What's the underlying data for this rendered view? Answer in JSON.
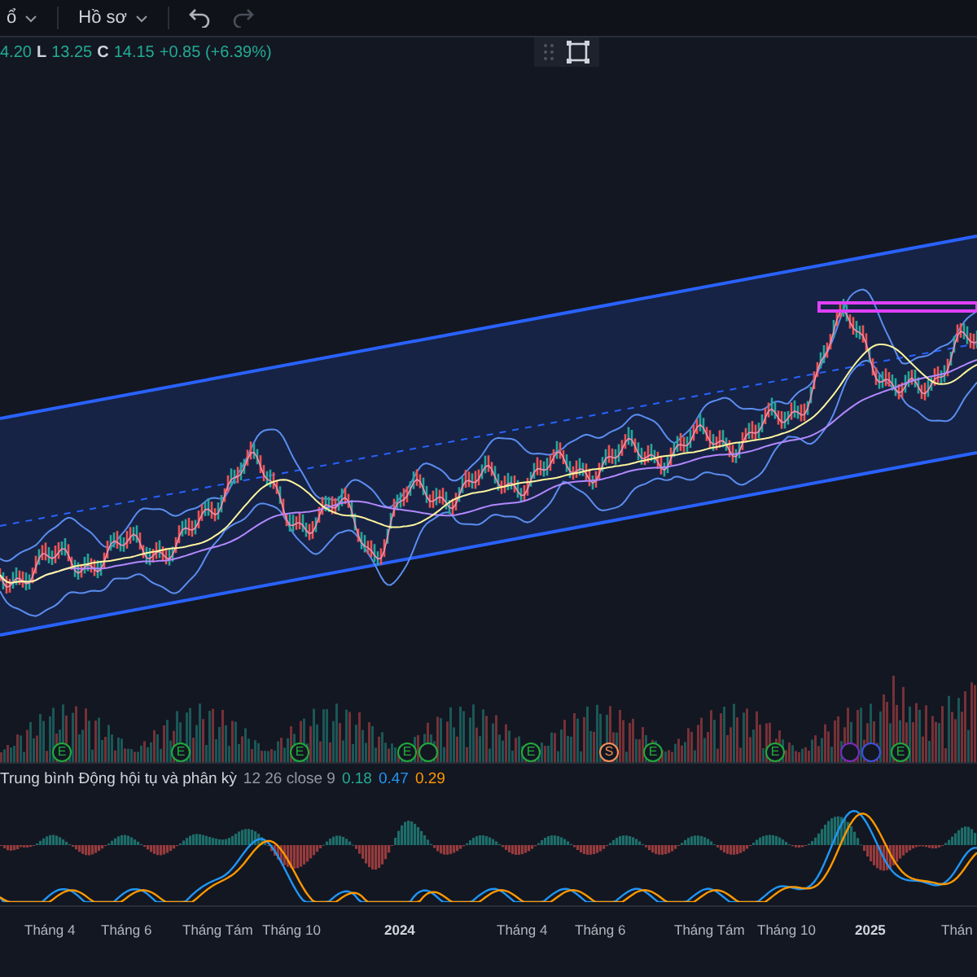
{
  "toolbar": {
    "menus": [
      {
        "label": "ổ"
      },
      {
        "label": "Hồ sơ"
      }
    ]
  },
  "legend": {
    "items": [
      {
        "value": "4.20"
      },
      {
        "key": "L",
        "value": "13.25"
      },
      {
        "key": "C",
        "value": "14.15"
      }
    ],
    "change": "+0.85 (+6.39%)"
  },
  "events": [
    {
      "kind": "letter",
      "letter": "E",
      "color": "#22ab3c"
    },
    {
      "kind": "letter",
      "letter": "E",
      "color": "#22ab3c"
    },
    {
      "kind": "letter",
      "letter": "E",
      "color": "#22ab3c"
    },
    {
      "kind": "letter",
      "letter": "E",
      "color": "#22ab3c"
    },
    {
      "kind": "dot",
      "color": "#22ab3c"
    },
    {
      "kind": "letter",
      "letter": "E",
      "color": "#22ab3c"
    },
    {
      "kind": "letter",
      "letter": "S",
      "color": "#f7925a"
    },
    {
      "kind": "letter",
      "letter": "E",
      "color": "#22ab3c"
    },
    {
      "kind": "letter",
      "letter": "E",
      "color": "#22ab3c"
    },
    {
      "kind": "dot",
      "color": "#7b2cbf"
    },
    {
      "kind": "dot",
      "color": "#3f51e0"
    },
    {
      "kind": "letter",
      "letter": "E",
      "color": "#22ab3c"
    }
  ],
  "macd": {
    "title": "Trung bình Động hội tụ và phân kỳ",
    "params": "12 26 close 9",
    "values": [
      {
        "text": "0.18",
        "color": "#22ab94"
      },
      {
        "text": "0.47",
        "color": "#2196f3"
      },
      {
        "text": "0.29",
        "color": "#ff9800"
      }
    ]
  },
  "x_axis": {
    "labels": [
      "Tháng 4",
      "Tháng 6",
      "Tháng Tám",
      "Tháng 10",
      "2024",
      "Tháng 4",
      "Tháng 6",
      "Tháng Tám",
      "Tháng 10",
      "2025",
      "Thán"
    ]
  }
}
